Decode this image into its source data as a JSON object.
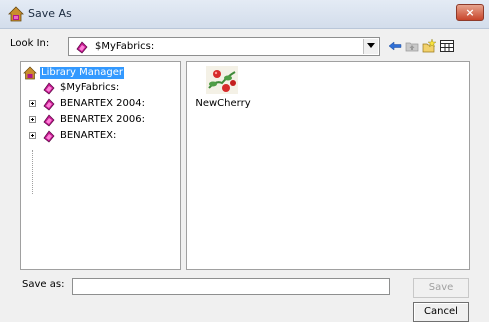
{
  "window": {
    "title": "Save As"
  },
  "look_in": {
    "label": "Look In:",
    "value": "$MyFabrics:"
  },
  "toolbar": {
    "icons": [
      "back-arrow-icon",
      "up-folder-icon",
      "new-folder-icon",
      "list-view-icon"
    ]
  },
  "tree": {
    "items": [
      {
        "label": "Library Manager",
        "selected": true
      },
      {
        "label": "$MyFabrics:"
      },
      {
        "label": "BENARTEX 2004:"
      },
      {
        "label": "BENARTEX 2006:"
      },
      {
        "label": "BENARTEX:"
      }
    ]
  },
  "files": {
    "items": [
      {
        "label": "NewCherry"
      }
    ]
  },
  "save_as": {
    "label": "Save as:",
    "value": ""
  },
  "buttons": {
    "save": "Save",
    "cancel": "Cancel"
  },
  "colors": {
    "selection": "#3399ff",
    "close_button": "#c8452b",
    "fabric_icon": "#c2188f"
  }
}
